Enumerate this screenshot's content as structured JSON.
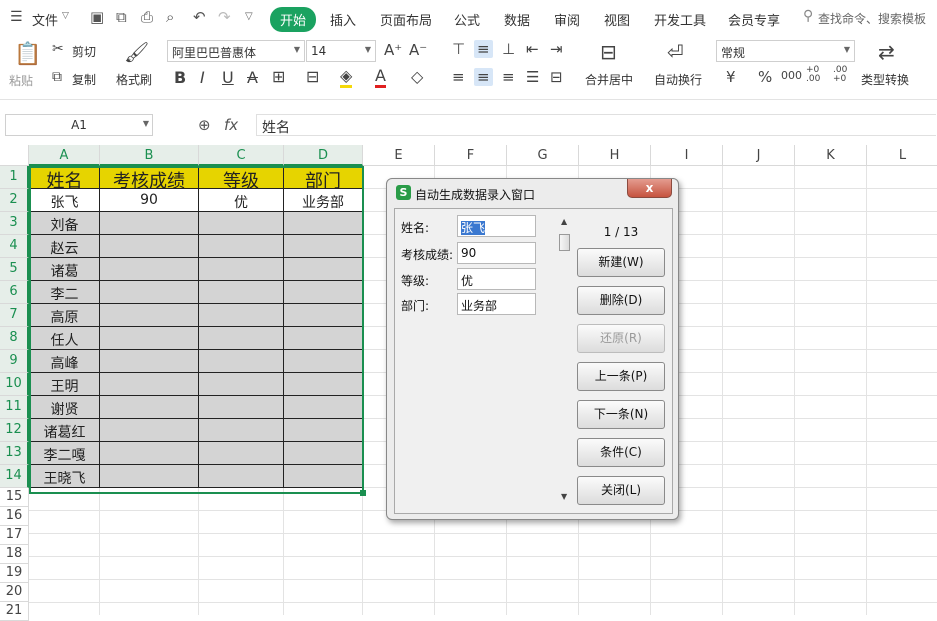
{
  "menubar": {
    "file": "文件",
    "tabs": [
      "开始",
      "插入",
      "页面布局",
      "公式",
      "数据",
      "审阅",
      "视图",
      "开发工具",
      "会员专享"
    ],
    "search": "查找命令、搜索模板"
  },
  "ribbon": {
    "paste": "粘贴",
    "cut": "剪切",
    "copy": "复制",
    "format_painter": "格式刷",
    "font_name": "阿里巴巴普惠体",
    "font_size": "14",
    "merge": "合并居中",
    "wrap": "自动换行",
    "number_format": "常规",
    "type_convert": "类型转换",
    "currency_symbol": "¥",
    "percent_symbol": "%",
    "thousands_symbol": "000",
    "inc_decimal": "+0 .00",
    "dec_decimal": ".00 +0"
  },
  "formula_bar": {
    "name_box": "A1",
    "fx": "fx",
    "value": "姓名"
  },
  "sheet": {
    "columns": [
      "A",
      "B",
      "C",
      "D",
      "E",
      "F",
      "G",
      "H",
      "I",
      "J",
      "K",
      "L"
    ],
    "rows": [
      "1",
      "2",
      "3",
      "4",
      "5",
      "6",
      "7",
      "8",
      "9",
      "10",
      "11",
      "12",
      "13",
      "14",
      "15",
      "16",
      "17",
      "18",
      "19",
      "20",
      "21"
    ],
    "headers": [
      "姓名",
      "考核成绩",
      "等级",
      "部门"
    ],
    "data": [
      [
        "张飞",
        "90",
        "优",
        "业务部"
      ],
      [
        "刘备",
        "",
        "",
        ""
      ],
      [
        "赵云",
        "",
        "",
        ""
      ],
      [
        "诸葛",
        "",
        "",
        ""
      ],
      [
        "李二",
        "",
        "",
        ""
      ],
      [
        "高原",
        "",
        "",
        ""
      ],
      [
        "任人",
        "",
        "",
        ""
      ],
      [
        "高峰",
        "",
        "",
        ""
      ],
      [
        "王明",
        "",
        "",
        ""
      ],
      [
        "谢贤",
        "",
        "",
        ""
      ],
      [
        "诸葛红",
        "",
        "",
        ""
      ],
      [
        "李二嘎",
        "",
        "",
        ""
      ],
      [
        "王晓飞",
        "",
        "",
        ""
      ]
    ]
  },
  "dialog": {
    "logo": "S",
    "title": "自动生成数据录入窗口",
    "close": "x",
    "counter": "1 / 13",
    "fields": [
      {
        "label": "姓名:",
        "value": "张飞"
      },
      {
        "label": "考核成绩:",
        "value": "90"
      },
      {
        "label": "等级:",
        "value": "优"
      },
      {
        "label": "部门:",
        "value": "业务部"
      }
    ],
    "buttons": [
      "新建(W)",
      "删除(D)",
      "还原(R)",
      "上一条(P)",
      "下一条(N)",
      "条件(C)",
      "关闭(L)"
    ]
  },
  "colors": {
    "accent": "#1aa260",
    "header_fill": "#e6d400",
    "data_fill": "#d4d4d4",
    "selection": "#1a8f50"
  }
}
